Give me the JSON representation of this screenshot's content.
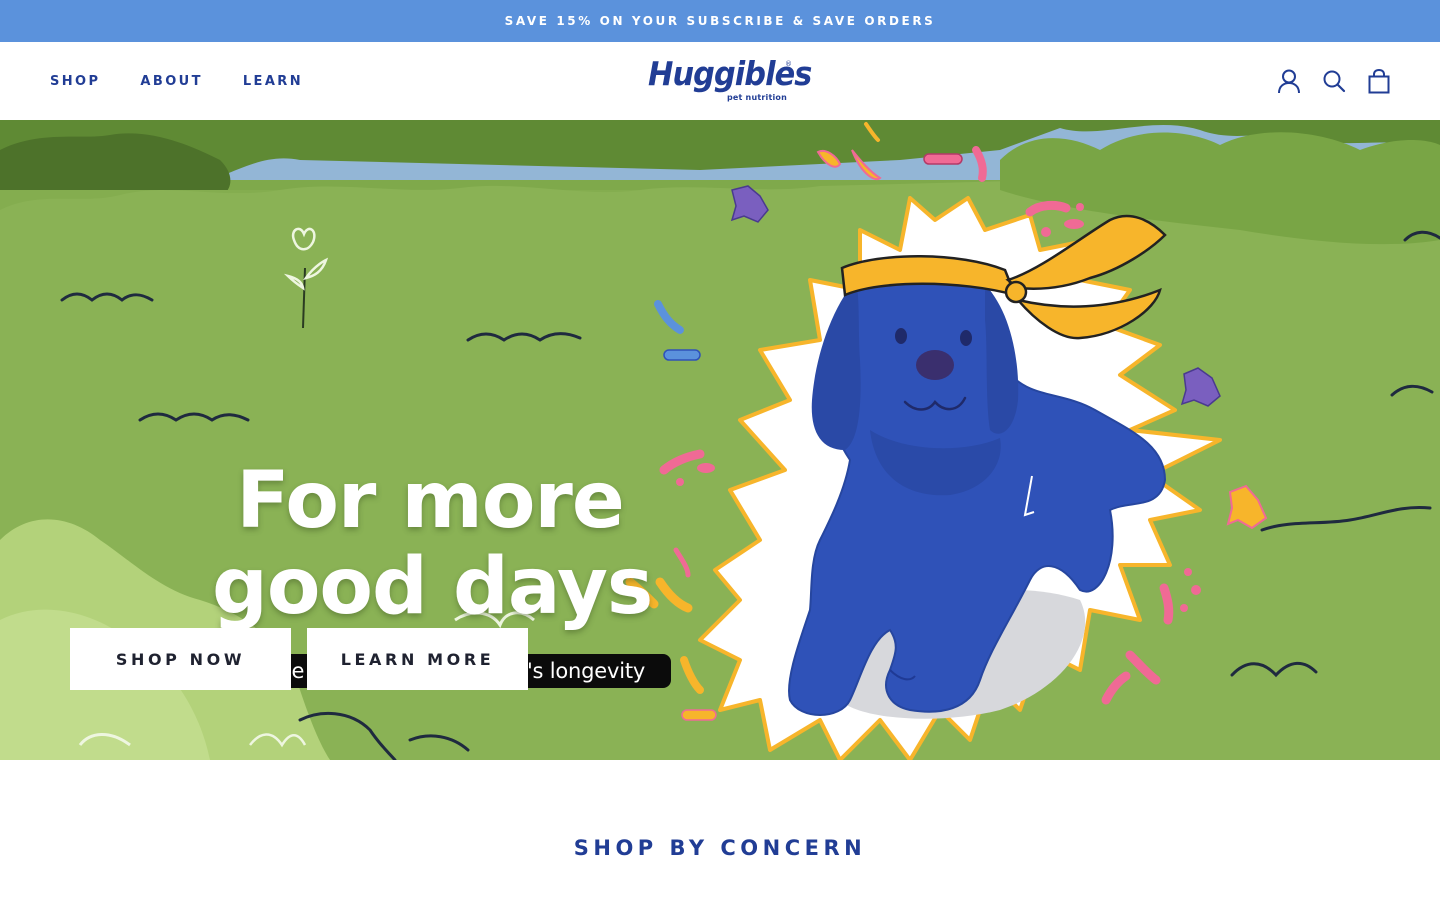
{
  "announcement": "SAVE 15% ON YOUR SUBSCRIBE & SAVE ORDERS",
  "nav": {
    "items": [
      {
        "label": "SHOP"
      },
      {
        "label": "ABOUT"
      },
      {
        "label": "LEARN"
      }
    ]
  },
  "logo": {
    "name": "Huggibles",
    "subtitle": "pet nutrition",
    "registered": "®"
  },
  "header_icons": [
    "account-icon",
    "search-icon",
    "cart-icon"
  ],
  "hero": {
    "headline_line1": "For more",
    "headline_line2": "good days",
    "tagline": "Proactive wellness for your pet's longevity",
    "buttons": {
      "shop_now": "SHOP NOW",
      "learn_more": "LEARN MORE"
    }
  },
  "section": {
    "title": "SHOP BY CONCERN"
  },
  "colors": {
    "announcement_bg": "#5b92dc",
    "brand_blue": "#213d95",
    "hero_green": "#7fa94b",
    "dog_blue": "#2f52b8",
    "accent_yellow": "#f7b52b",
    "accent_pink": "#f06a95"
  }
}
